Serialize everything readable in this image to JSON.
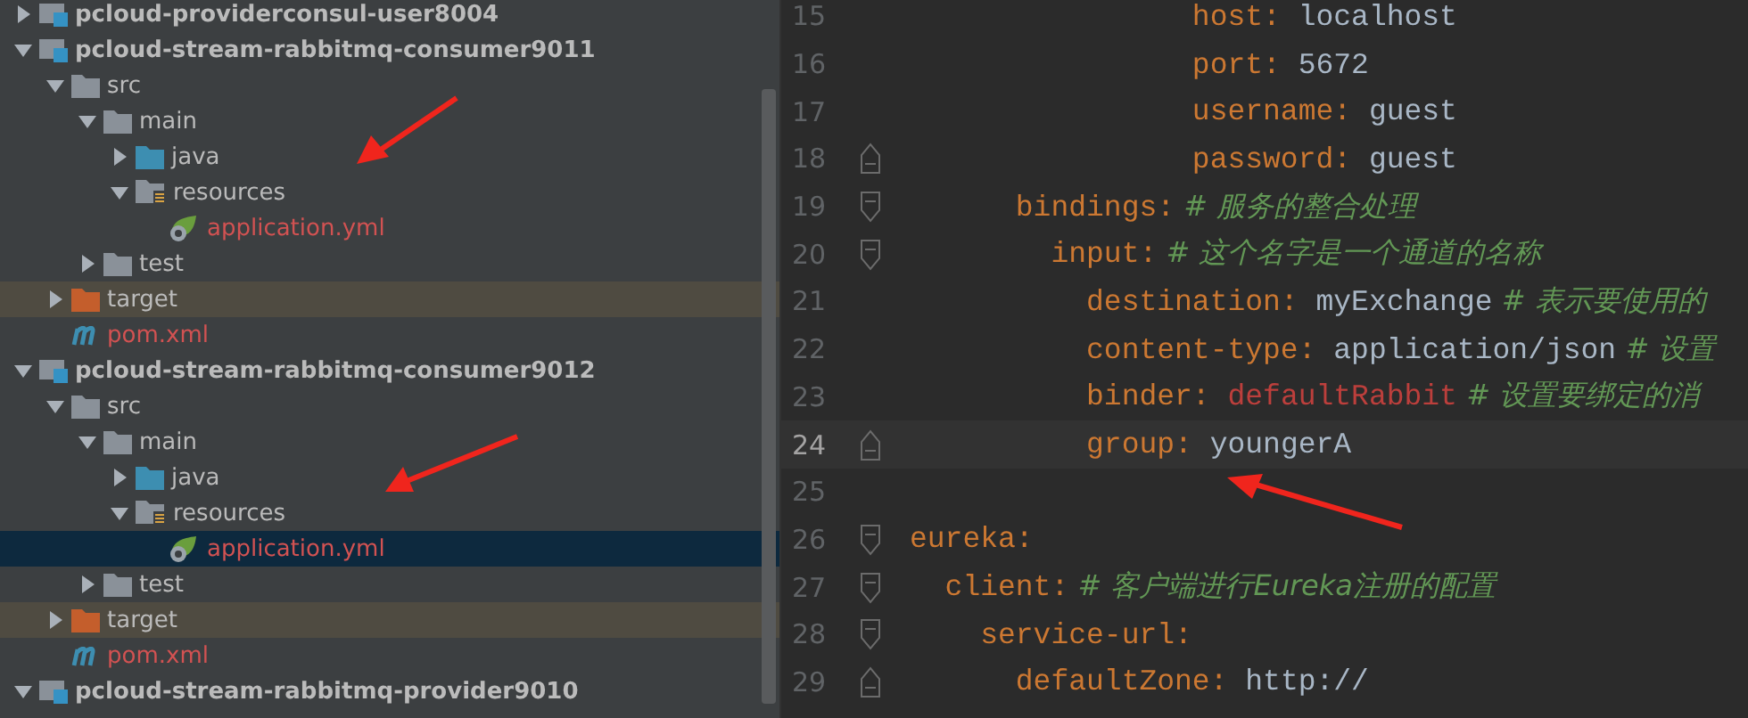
{
  "project_tree": [
    {
      "label": "pcloud-providerconsul-user8004",
      "kind": "module",
      "expanded": false,
      "selected": false
    },
    {
      "label": "pcloud-stream-rabbitmq-consumer9011",
      "kind": "module",
      "expanded": true,
      "selected": false,
      "children": [
        {
          "label": "src",
          "kind": "folder",
          "expanded": true,
          "selected": false,
          "children": [
            {
              "label": "main",
              "kind": "folder",
              "expanded": true,
              "selected": false,
              "children": [
                {
                  "label": "java",
                  "kind": "source",
                  "expanded": false,
                  "selected": false
                },
                {
                  "label": "resources",
                  "kind": "resources",
                  "expanded": true,
                  "selected": false,
                  "children": [
                    {
                      "label": "application.yml",
                      "kind": "yml",
                      "selected": false
                    }
                  ]
                }
              ]
            },
            {
              "label": "test",
              "kind": "folder",
              "expanded": false,
              "selected": false
            }
          ]
        },
        {
          "label": "target",
          "kind": "excluded",
          "expanded": false,
          "selected": false
        },
        {
          "label": "pom.xml",
          "kind": "maven",
          "selected": false
        }
      ]
    },
    {
      "label": "pcloud-stream-rabbitmq-consumer9012",
      "kind": "module",
      "expanded": true,
      "selected": false,
      "children": [
        {
          "label": "src",
          "kind": "folder",
          "expanded": true,
          "selected": false,
          "children": [
            {
              "label": "main",
              "kind": "folder",
              "expanded": true,
              "selected": false,
              "children": [
                {
                  "label": "java",
                  "kind": "source",
                  "expanded": false,
                  "selected": false
                },
                {
                  "label": "resources",
                  "kind": "resources",
                  "expanded": true,
                  "selected": false,
                  "children": [
                    {
                      "label": "application.yml",
                      "kind": "yml",
                      "selected": true
                    }
                  ]
                }
              ]
            },
            {
              "label": "test",
              "kind": "folder",
              "expanded": false,
              "selected": false
            }
          ]
        },
        {
          "label": "target",
          "kind": "excluded",
          "expanded": false,
          "selected": false
        },
        {
          "label": "pom.xml",
          "kind": "maven",
          "selected": false
        }
      ]
    },
    {
      "label": "pcloud-stream-rabbitmq-provider9010",
      "kind": "module",
      "expanded": true,
      "selected": false
    }
  ],
  "editor": {
    "lines": [
      {
        "number": "15",
        "key": "                host:",
        "value": {
          "text": "localhost",
          "kind": "plain"
        },
        "current": false
      },
      {
        "number": "16",
        "key": "                port:",
        "value": {
          "text": "5672",
          "kind": "plain"
        },
        "current": false
      },
      {
        "number": "17",
        "key": "                username:",
        "value": {
          "text": "guest",
          "kind": "plain"
        },
        "current": false
      },
      {
        "number": "18",
        "key": "                password:",
        "value": {
          "text": "guest",
          "kind": "plain"
        },
        "current": false,
        "fold_marker": {
          "kind": "end"
        }
      },
      {
        "number": "19",
        "key": "      bindings:",
        "comment": "# 服务的整合处理",
        "current": false,
        "fold_marker": {
          "kind": "start"
        }
      },
      {
        "number": "20",
        "key": "        input:",
        "comment": "# 这个名字是一个通道的名称",
        "current": false,
        "fold_marker": {
          "kind": "start"
        }
      },
      {
        "number": "21",
        "key": "          destination:",
        "value": {
          "text": "myExchange",
          "kind": "plain"
        },
        "comment": "# 表示要使用的",
        "current": false
      },
      {
        "number": "22",
        "key": "          content-type:",
        "value": {
          "text": "application/json",
          "kind": "plain"
        },
        "comment": "# 设置",
        "current": false
      },
      {
        "number": "23",
        "key": "          binder:",
        "value": {
          "text": "defaultRabbit",
          "kind": "error"
        },
        "comment": "# 设置要绑定的消",
        "current": false
      },
      {
        "number": "24",
        "key": "          group:",
        "value": {
          "text": "youngerA",
          "kind": "plain"
        },
        "current": true,
        "fold_marker": {
          "kind": "end"
        }
      },
      {
        "number": "25",
        "current": false
      },
      {
        "number": "26",
        "key": "eureka:",
        "current": false,
        "fold_marker": {
          "kind": "start"
        }
      },
      {
        "number": "27",
        "key": "  client:",
        "comment": "# 客户端进行Eureka注册的配置",
        "current": false,
        "fold_marker": {
          "kind": "start"
        }
      },
      {
        "number": "28",
        "key": "    service-url:",
        "current": false,
        "fold_marker": {
          "kind": "start"
        }
      },
      {
        "number": "29",
        "key": "      defaultZone:",
        "value": {
          "text": "http://",
          "kind": "plain"
        },
        "current": false,
        "fold_marker": {
          "kind": "end"
        }
      }
    ]
  }
}
